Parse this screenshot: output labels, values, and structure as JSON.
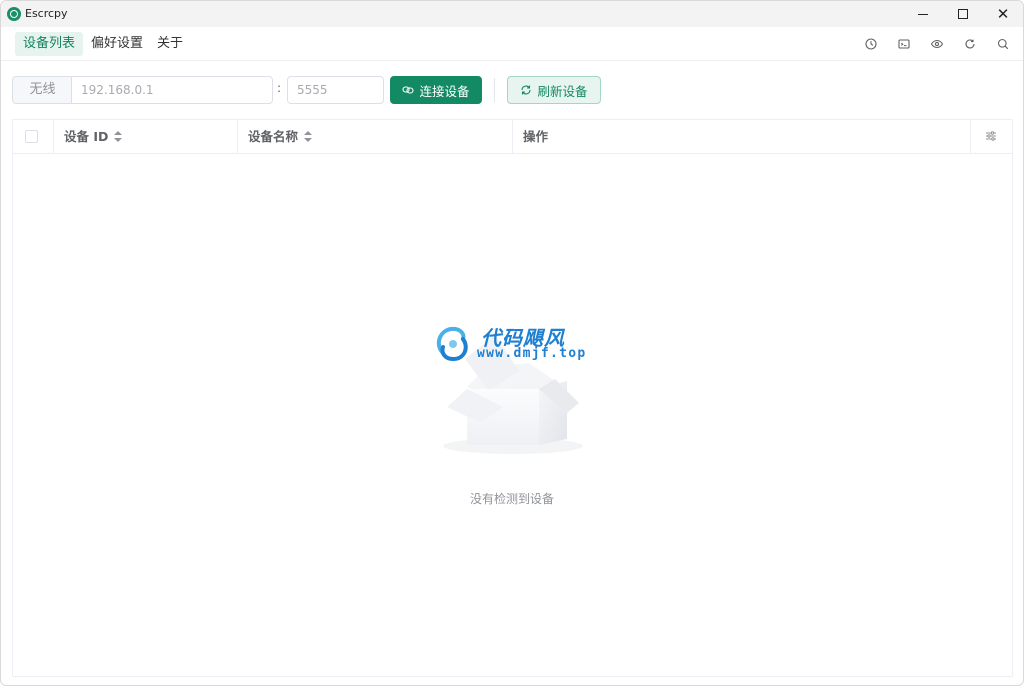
{
  "window": {
    "title": "Escrcpy",
    "brand_color": "#138a63"
  },
  "menu": {
    "items": [
      {
        "label": "设备列表",
        "active": true
      },
      {
        "label": "偏好设置",
        "active": false
      },
      {
        "label": "关于",
        "active": false
      }
    ],
    "tool_icons": [
      "clock-icon",
      "terminal-icon",
      "eye-icon",
      "refresh-icon",
      "search-icon"
    ]
  },
  "connect": {
    "addon_label": "无线",
    "ip_placeholder": "192.168.0.1",
    "separator": ":",
    "port_placeholder": "5555",
    "connect_label": "连接设备",
    "refresh_label": "刷新设备"
  },
  "table": {
    "columns": [
      "设备 ID",
      "设备名称",
      "操作"
    ],
    "empty_text": "没有检测到设备"
  },
  "watermark": {
    "title": "代码飓风",
    "url": "www.dmjf.top"
  }
}
